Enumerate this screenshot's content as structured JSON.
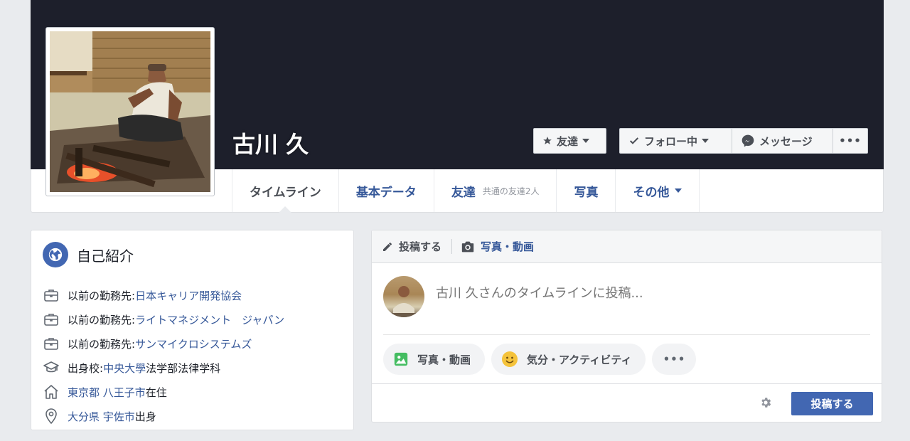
{
  "profile": {
    "name": "古川 久"
  },
  "cover_actions": {
    "friend_label": "友達",
    "follow_label": "フォロー中",
    "message_label": "メッセージ",
    "more_label": "•••"
  },
  "nav": {
    "tabs": [
      {
        "label": "タイムライン",
        "active": true
      },
      {
        "label": "基本データ"
      },
      {
        "label": "友達",
        "sub": "共通の友達2人"
      },
      {
        "label": "写真"
      },
      {
        "label": "その他"
      }
    ]
  },
  "intro": {
    "title": "自己紹介",
    "rows": [
      {
        "icon": "briefcase-icon",
        "prefix": "以前の勤務先: ",
        "link": "日本キャリア開発協会"
      },
      {
        "icon": "briefcase-icon",
        "prefix": "以前の勤務先: ",
        "link": "ライトマネジメント　ジャパン"
      },
      {
        "icon": "briefcase-icon",
        "prefix": "以前の勤務先: ",
        "link": "サンマイクロシステムズ"
      },
      {
        "icon": "graduation-cap-icon",
        "prefix": "出身校: ",
        "link": "中央大學",
        "suffix": " 法学部法律学科"
      },
      {
        "icon": "house-icon",
        "link": "東京都 八王子市",
        "suffix": "在住"
      },
      {
        "icon": "location-pin-icon",
        "link": "大分県 宇佐市",
        "suffix": "出身"
      }
    ]
  },
  "composer": {
    "tab_post": "投稿する",
    "tab_photo": "写真・動画",
    "placeholder": "古川 久さんのタイムラインに投稿...",
    "pill_photo": "写真・動画",
    "pill_feeling": "気分・アクティビティ",
    "pill_more": "•••",
    "post_button": "投稿する"
  },
  "colors": {
    "brand": "#4267b2",
    "link": "#365899",
    "cover": "#1d1f2b"
  }
}
